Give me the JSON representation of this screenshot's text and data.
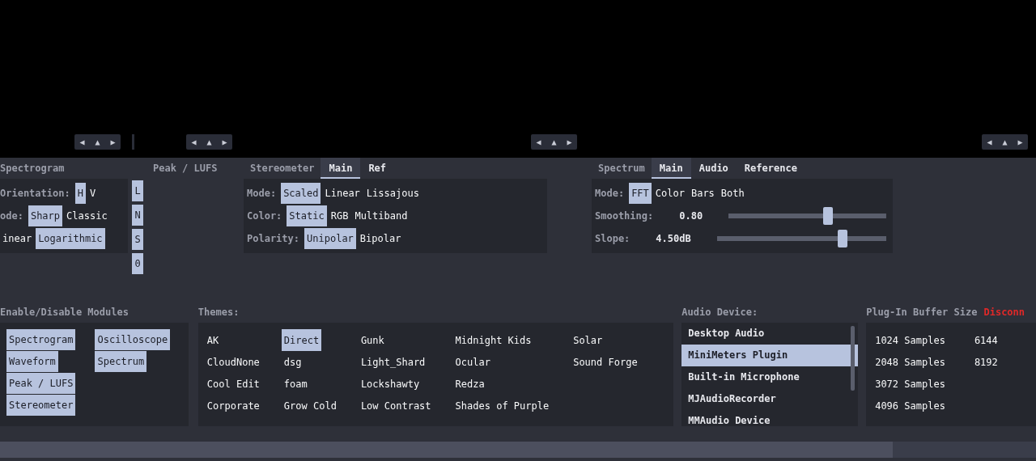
{
  "top_bar": {
    "button_groups": [
      {
        "buttons": [
          "◀",
          "▲",
          "▶"
        ]
      },
      {
        "buttons": [
          "◀",
          "▲",
          "▶"
        ]
      },
      {
        "buttons": [
          "◀",
          "▲",
          "▶"
        ]
      },
      {
        "buttons": [
          "◀",
          "▲",
          "▶"
        ]
      }
    ]
  },
  "spectrogram": {
    "title": "Spectrogram",
    "rows": [
      {
        "label": "Orientation:",
        "options": [
          {
            "label": "H",
            "selected": true
          },
          {
            "label": "V",
            "selected": false
          }
        ]
      },
      {
        "label": "ode:",
        "options": [
          {
            "label": "Sharp",
            "selected": true
          },
          {
            "label": "Classic",
            "selected": false
          }
        ]
      },
      {
        "options": [
          {
            "label": "inear",
            "selected": false
          },
          {
            "label": "Logarithmic",
            "selected": true
          }
        ]
      }
    ]
  },
  "peak_lufs": {
    "title": "Peak / LUFS",
    "buttons": [
      {
        "label": "L",
        "selected": true
      },
      {
        "label": "N",
        "selected": true
      },
      {
        "label": "S",
        "selected": true
      },
      {
        "label": "0",
        "selected": true
      }
    ]
  },
  "stereometer": {
    "title": "Stereometer",
    "tabs": [
      {
        "label": "Main",
        "selected": true
      },
      {
        "label": "Ref",
        "selected": false
      }
    ],
    "rows": [
      {
        "label": "Mode:",
        "options": [
          {
            "label": "Scaled",
            "selected": true
          },
          {
            "label": "Linear",
            "selected": false
          },
          {
            "label": "Lissajous",
            "selected": false
          }
        ]
      },
      {
        "label": "Color:",
        "options": [
          {
            "label": "Static",
            "selected": true
          },
          {
            "label": "RGB",
            "selected": false
          },
          {
            "label": "Multiband",
            "selected": false
          }
        ]
      },
      {
        "label": "Polarity:",
        "options": [
          {
            "label": "Unipolar",
            "selected": true
          },
          {
            "label": "Bipolar",
            "selected": false
          }
        ]
      }
    ]
  },
  "spectrum": {
    "title": "Spectrum",
    "tabs": [
      {
        "label": "Main",
        "selected": true
      },
      {
        "label": "Audio",
        "selected": false
      },
      {
        "label": "Reference",
        "selected": false
      }
    ],
    "mode": {
      "label": "Mode:",
      "options": [
        {
          "label": "FFT",
          "selected": true
        },
        {
          "label": "Color",
          "selected": false
        },
        {
          "label": "Bars",
          "selected": false
        },
        {
          "label": "Both",
          "selected": false
        }
      ]
    },
    "sliders": [
      {
        "label": "Smoothing:",
        "reading": "0.80",
        "level": 0.63
      },
      {
        "label": "Slope:",
        "reading": "4.50dB",
        "level": 0.74
      }
    ]
  },
  "modules": {
    "title": "Enable/Disable Modules",
    "items": [
      {
        "label": "Spectrogram",
        "checked": true
      },
      {
        "label": "Waveform",
        "checked": true
      },
      {
        "label": "Peak / LUFS",
        "checked": true
      },
      {
        "label": "Stereometer",
        "checked": true
      },
      {
        "label": "Oscilloscope",
        "checked": true
      },
      {
        "label": "Spectrum",
        "checked": true
      }
    ]
  },
  "themes": {
    "title": "Themes:",
    "items": [
      {
        "label": "AK",
        "selected": false
      },
      {
        "label": "CloudNone",
        "selected": false
      },
      {
        "label": "Cool Edit",
        "selected": false
      },
      {
        "label": "Corporate",
        "selected": false
      },
      {
        "label": "Direct",
        "selected": true
      },
      {
        "label": "dsg",
        "selected": false
      },
      {
        "label": "foam",
        "selected": false
      },
      {
        "label": "Grow Cold",
        "selected": false
      },
      {
        "label": "Gunk",
        "selected": false
      },
      {
        "label": "Light_Shard",
        "selected": false
      },
      {
        "label": "Lockshawty",
        "selected": false
      },
      {
        "label": "Low Contrast",
        "selected": false
      },
      {
        "label": "Midnight Kids",
        "selected": false
      },
      {
        "label": "Ocular",
        "selected": false
      },
      {
        "label": "Redza",
        "selected": false
      },
      {
        "label": "Shades of Purple",
        "selected": false
      },
      {
        "label": "Solar",
        "selected": false
      },
      {
        "label": "Sound Forge",
        "selected": false
      }
    ]
  },
  "audio_device": {
    "title": "Audio Device:",
    "items": [
      {
        "label": "Desktop Audio",
        "selected": false
      },
      {
        "label": "MiniMeters Plugin",
        "selected": true
      },
      {
        "label": "Built-in Microphone",
        "selected": false
      },
      {
        "label": "MJAudioRecorder",
        "selected": false
      },
      {
        "label": "MMAudio Device",
        "selected": false
      }
    ]
  },
  "buffer": {
    "title": "Plug-In Buffer Size",
    "status": "Disconn",
    "items": [
      {
        "label": "1024 Samples",
        "selected": false
      },
      {
        "label": "2048 Samples",
        "selected": false
      },
      {
        "label": "3072 Samples",
        "selected": false
      },
      {
        "label": "4096 Samples",
        "selected": false
      },
      {
        "label": "6144",
        "selected": false
      },
      {
        "label": "8192",
        "selected": false
      }
    ]
  }
}
